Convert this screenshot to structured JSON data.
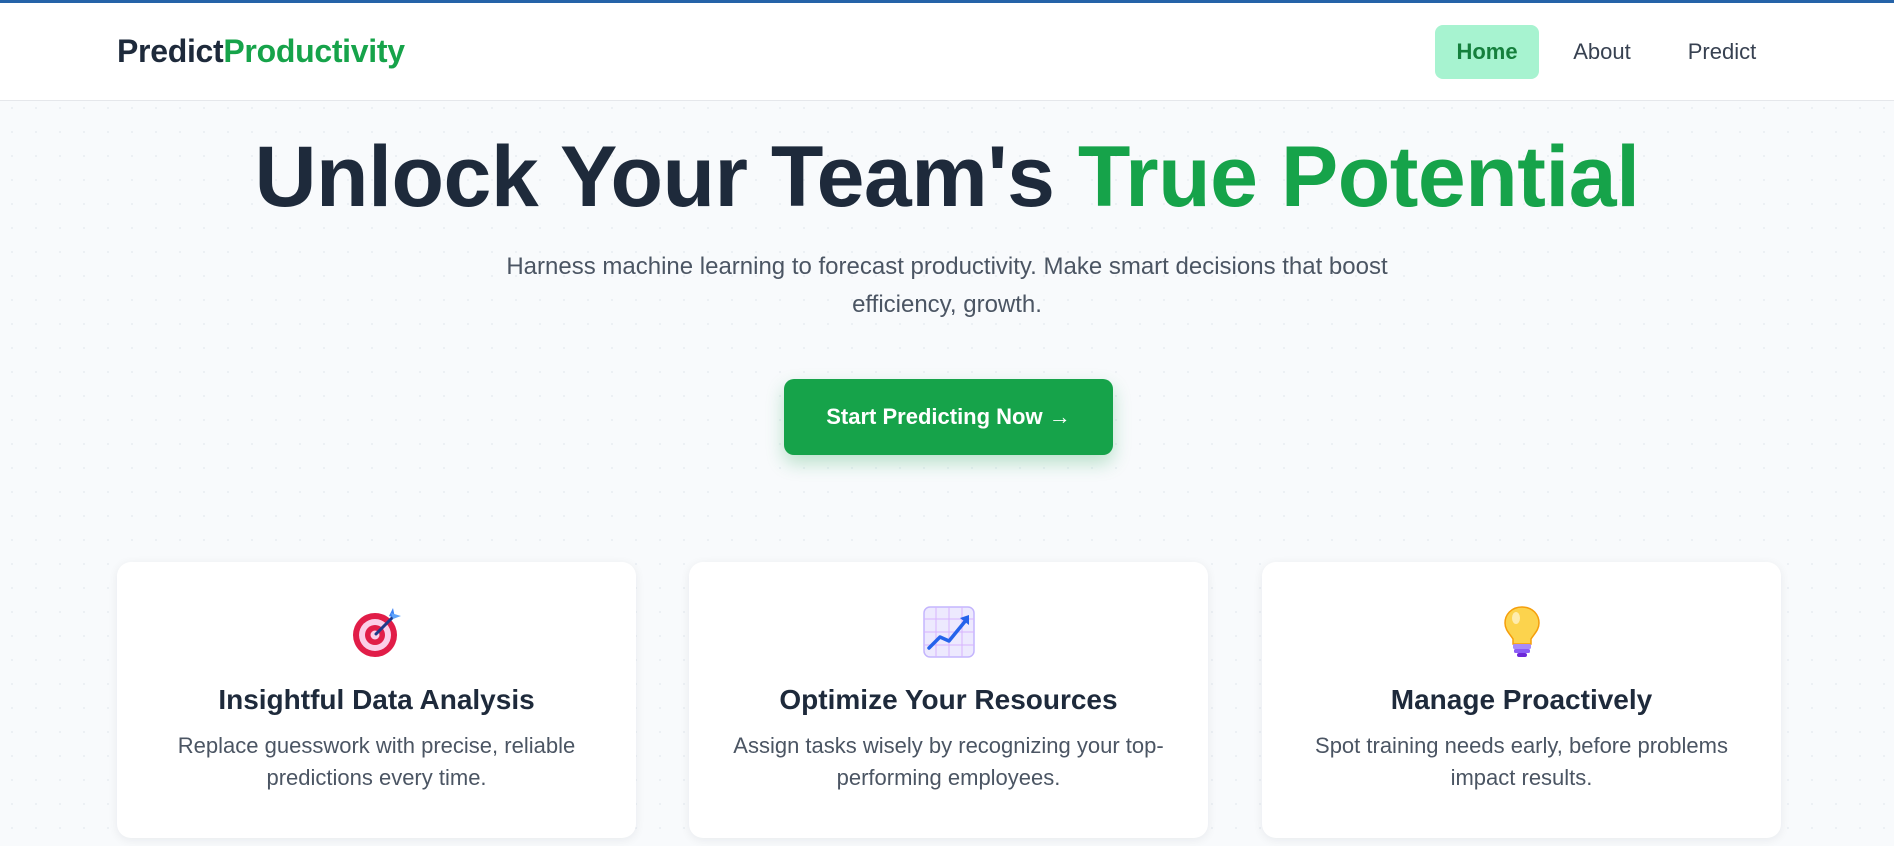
{
  "brand": {
    "part1": "Predict",
    "part2": "Productivity"
  },
  "nav": {
    "home": "Home",
    "about": "About",
    "predict": "Predict"
  },
  "hero": {
    "title_main": "Unlock Your Team's ",
    "title_accent": "True Potential",
    "subtitle": "Harness machine learning to forecast productivity. Make smart decisions that boost efficiency, growth.",
    "cta_label": "Start Predicting Now →"
  },
  "features": [
    {
      "icon": "target-icon",
      "title": "Insightful Data Analysis",
      "desc": "Replace guesswork with precise, reliable predictions every time."
    },
    {
      "icon": "chart-increasing-icon",
      "title": "Optimize Your Resources",
      "desc": "Assign tasks wisely by recognizing your top-performing employees."
    },
    {
      "icon": "lightbulb-icon",
      "title": "Manage Proactively",
      "desc": "Spot training needs early, before problems impact results."
    }
  ],
  "colors": {
    "accent": "#16a34a",
    "dark_text": "#1e2a3b",
    "nav_active_bg": "#a7f3d0",
    "top_border": "#2563a8"
  }
}
